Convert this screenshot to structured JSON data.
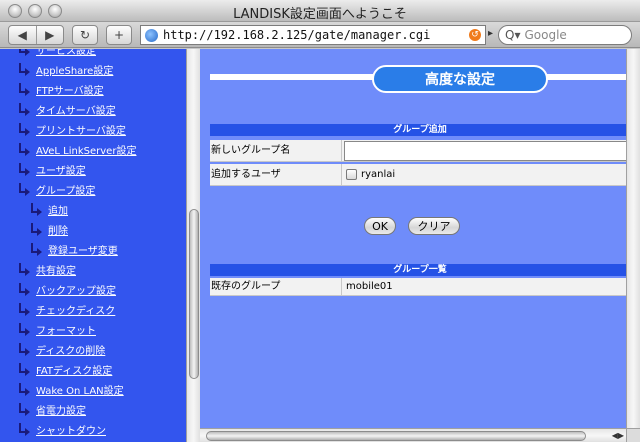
{
  "window": {
    "title": "LANDISK設定画面へようこそ"
  },
  "toolbar": {
    "back_icon": "◀",
    "forward_icon": "▶",
    "reload_icon": "↻",
    "add_icon": "+",
    "url": "http://192.168.2.125/gate/manager.cgi",
    "search_placeholder": "Google",
    "search_icon": "Q▾",
    "chevron": "▸"
  },
  "sidebar": {
    "items": [
      {
        "label": "サービス設定",
        "sub": false
      },
      {
        "label": "AppleShare設定",
        "sub": false
      },
      {
        "label": "FTPサーバ設定",
        "sub": false
      },
      {
        "label": "タイムサーバ設定",
        "sub": false
      },
      {
        "label": "プリントサーバ設定",
        "sub": false
      },
      {
        "label": "AVeL LinkServer設定",
        "sub": false
      },
      {
        "label": "ユーザ設定",
        "sub": false
      },
      {
        "label": "グループ設定",
        "sub": false
      },
      {
        "label": "追加",
        "sub": true
      },
      {
        "label": "削除",
        "sub": true
      },
      {
        "label": "登録ユーザ変更",
        "sub": true
      },
      {
        "label": "共有設定",
        "sub": false
      },
      {
        "label": "バックアップ設定",
        "sub": false
      },
      {
        "label": "チェックディスク",
        "sub": false
      },
      {
        "label": "フォーマット",
        "sub": false
      },
      {
        "label": "ディスクの削除",
        "sub": false
      },
      {
        "label": "FATディスク設定",
        "sub": false
      },
      {
        "label": "Wake On LAN設定",
        "sub": false
      },
      {
        "label": "省電力設定",
        "sub": false
      },
      {
        "label": "シャットダウン",
        "sub": false
      }
    ]
  },
  "main": {
    "page_title": "高度な設定",
    "add_group": {
      "section_title": "グループ追加",
      "new_group_label": "新しいグループ名",
      "new_group_value": "",
      "users_label": "追加するユーザ",
      "user_option": "ryanlai",
      "ok_button": "OK",
      "clear_button": "クリア"
    },
    "group_list": {
      "section_title": "グループ一覧",
      "existing_label": "既存のグループ",
      "existing_value": "mobile01"
    }
  }
}
